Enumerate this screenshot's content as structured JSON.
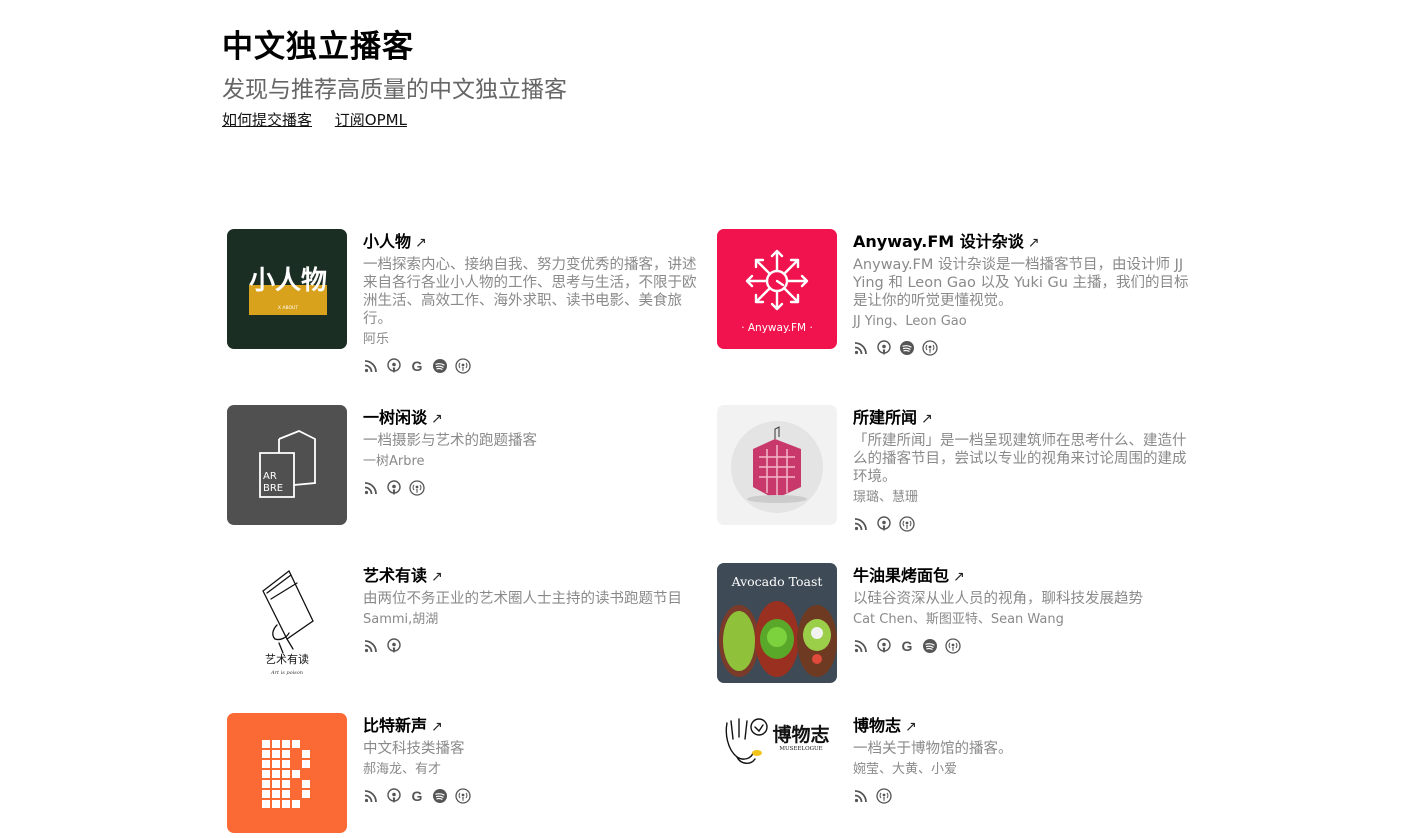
{
  "header": {
    "title": "中文独立播客",
    "subtitle": "发现与推荐高质量的中文独立播客",
    "links": [
      "如何提交播客",
      "订阅OPML"
    ]
  },
  "podcasts": [
    {
      "name": "小人物",
      "arrow": "↗",
      "description": "一档探索内心、接纳自我、努力变优秀的播客，讲述来自各行各业小人物的工作、思考与生活，不限于欧洲生活、高效工作、海外求职、读书电影、美食旅行。",
      "hosts": "阿乐",
      "cover_text": "小人物",
      "cover_subtext": "X ABOUT",
      "icons": [
        "rss-icon",
        "apple-podcasts-icon",
        "google-podcasts-icon",
        "spotify-icon",
        "podcast-antenna-icon"
      ]
    },
    {
      "name": "Anyway.FM 设计杂谈",
      "arrow": "↗",
      "description": "Anyway.FM 设计杂谈是一档播客节目，由设计师 JJ Ying 和 Leon Gao 以及 Yuki Gu 主播，我们的目标是让你的听觉更懂视觉。",
      "hosts": "JJ Ying、Leon Gao",
      "cover_text": "· Anyway.FM ·",
      "icons": [
        "rss-icon",
        "apple-podcasts-icon",
        "spotify-icon",
        "podcast-antenna-icon"
      ]
    },
    {
      "name": "一树闲谈",
      "arrow": "↗",
      "description": "一档摄影与艺术的跑题播客",
      "hosts": "一树Arbre",
      "cover_text": "AR BRE",
      "icons": [
        "rss-icon",
        "apple-podcasts-icon",
        "podcast-antenna-icon"
      ]
    },
    {
      "name": "所建所闻",
      "arrow": "↗",
      "description": "「所建所闻」是一档呈现建筑师在思考什么、建造什么的播客节目，尝试以专业的视角来讨论周围的建成环境。",
      "hosts": "璟璐、慧珊",
      "icons": [
        "rss-icon",
        "apple-podcasts-icon",
        "podcast-antenna-icon"
      ]
    },
    {
      "name": "艺术有读",
      "arrow": "↗",
      "description": "由两位不务正业的艺术圈人士主持的读书跑题节目",
      "hosts": "Sammi,胡湖",
      "cover_text": "艺术有读",
      "cover_subtext": "Art is poison",
      "icons": [
        "rss-icon",
        "apple-podcasts-icon"
      ]
    },
    {
      "name": "牛油果烤面包",
      "arrow": "↗",
      "description": "以硅谷资深从业人员的视角，聊科技发展趋势",
      "hosts": "Cat Chen、斯图亚特、Sean Wang",
      "cover_text": "Avocado Toast",
      "icons": [
        "rss-icon",
        "apple-podcasts-icon",
        "google-podcasts-icon",
        "spotify-icon",
        "podcast-antenna-icon"
      ]
    },
    {
      "name": "比特新声",
      "arrow": "↗",
      "description": "中文科技类播客",
      "hosts": "郝海龙、有才",
      "icons": [
        "rss-icon",
        "apple-podcasts-icon",
        "google-podcasts-icon",
        "spotify-icon",
        "podcast-antenna-icon"
      ]
    },
    {
      "name": "博物志",
      "arrow": "↗",
      "description": "一档关于博物馆的播客。",
      "hosts": "婉莹、大黄、小爱",
      "cover_text": "博物志",
      "cover_subtext": "MUSEELOGUE",
      "icons": [
        "rss-icon",
        "podcast-antenna-icon"
      ]
    }
  ],
  "colors": {
    "anyway_red": "#f0134d",
    "arbre_gray": "#505050",
    "xiaorenwu_green": "#1a2e24",
    "xiaorenwu_gold": "#d8a21c",
    "bitxinsheng_orange": "#fb6a35"
  }
}
